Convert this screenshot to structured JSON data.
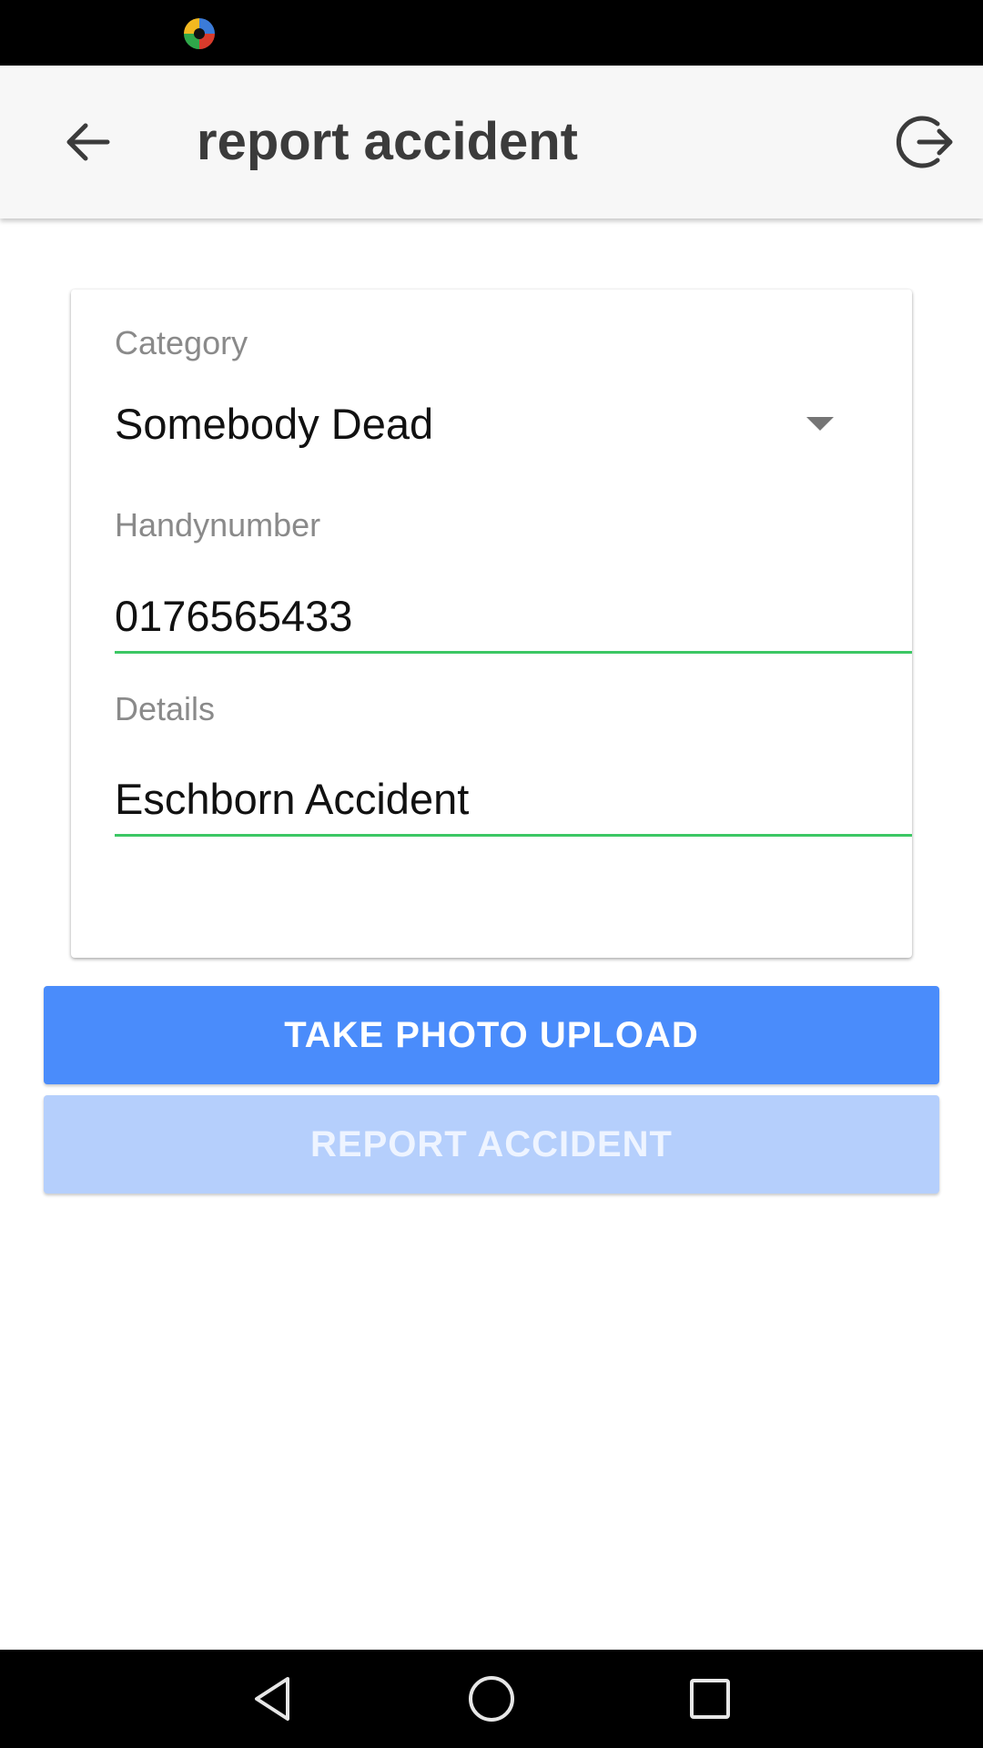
{
  "toolbar": {
    "title": "report accident",
    "back_icon": "arrow-left-icon",
    "logout_icon": "logout-icon"
  },
  "form": {
    "category_label": "Category",
    "category_value": "Somebody Dead",
    "handynumber_label": "Handynumber",
    "handynumber_value": "0176565433",
    "details_label": "Details",
    "details_value": "Eschborn Accident"
  },
  "actions": {
    "take_photo_label": "TAKE PHOTO UPLOAD",
    "report_label": "REPORT ACCIDENT"
  },
  "colors": {
    "primary": "#4a8cfb",
    "primary_disabled": "#b5cffc",
    "input_underline": "#3cc764",
    "toolbar_bg": "#f7f7f7"
  },
  "navigation": {
    "back_icon": "triangle-back-icon",
    "home_icon": "circle-home-icon",
    "recents_icon": "square-recents-icon"
  }
}
